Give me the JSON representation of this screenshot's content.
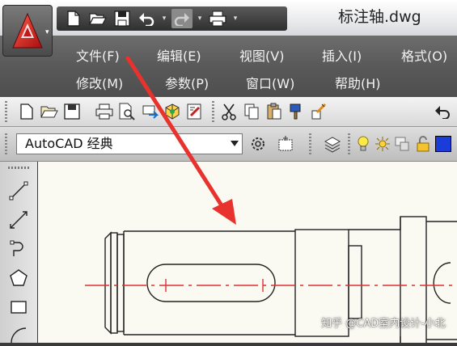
{
  "document": {
    "title": "标注轴.dwg"
  },
  "menu": {
    "row1": [
      {
        "label": "文件(F)"
      },
      {
        "label": "编辑(E)"
      },
      {
        "label": "视图(V)"
      },
      {
        "label": "插入(I)"
      },
      {
        "label": "格式(O)"
      }
    ],
    "row2": [
      {
        "label": "修改(M)"
      },
      {
        "label": "参数(P)"
      },
      {
        "label": "窗口(W)"
      },
      {
        "label": "帮助(H)"
      }
    ]
  },
  "workspace": {
    "selected": "AutoCAD 经典"
  },
  "watermark": {
    "text": "知乎 @CAD室内设计-小北"
  },
  "colors": {
    "arrow": "#e8322d",
    "centerline": "#e03030",
    "menubar": "#5a5a5a",
    "canvas": "#fbfaf2"
  }
}
